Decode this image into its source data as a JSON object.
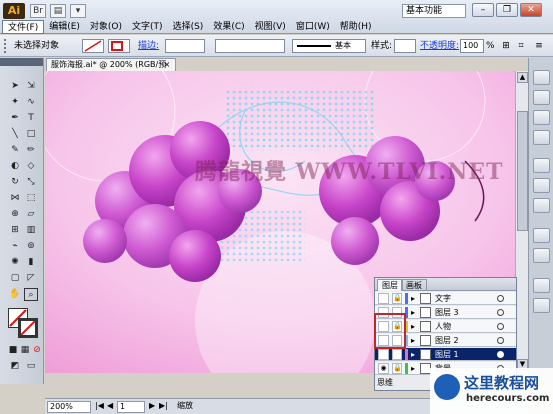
{
  "app": {
    "logo": "Ai",
    "workspace": "基本功能"
  },
  "menu": [
    "文件(F)",
    "编辑(E)",
    "对象(O)",
    "文字(T)",
    "选择(S)",
    "效果(C)",
    "视图(V)",
    "窗口(W)",
    "帮助(H)"
  ],
  "control_bar": {
    "selection_label": "未选择对象",
    "stroke_label": "描边:",
    "brush_label": "基本",
    "style_label": "样式:",
    "opacity_label": "不透明度:",
    "opacity_value": "100",
    "opacity_unit": "%"
  },
  "document": {
    "tab_title": "服饰海报.ai* @ 200% (RGB/预览)",
    "close_glyph": "×"
  },
  "canvas": {
    "watermark_text": "腾龍視覺 WWW.TLVI.NET"
  },
  "layers_panel": {
    "tabs": [
      "图层",
      "画板"
    ],
    "rows": [
      {
        "name": "文字",
        "color": "#4a6cff",
        "selected": false
      },
      {
        "name": "图层 3",
        "color": "#4a6cff",
        "selected": false
      },
      {
        "name": "人物",
        "color": "#c6c94a",
        "selected": false
      },
      {
        "name": "图层 2",
        "color": "#6ec4f0",
        "selected": false
      },
      {
        "name": "图层 1",
        "color": "#e46ad6",
        "selected": true
      },
      {
        "name": "背景",
        "color": "#3fbf4d",
        "selected": false
      }
    ],
    "footer": "思维"
  },
  "status_bar": {
    "zoom": "200%",
    "page": "1",
    "status": "缩放"
  },
  "watermark": {
    "title": "这里教程网",
    "url": "herecours.com"
  }
}
